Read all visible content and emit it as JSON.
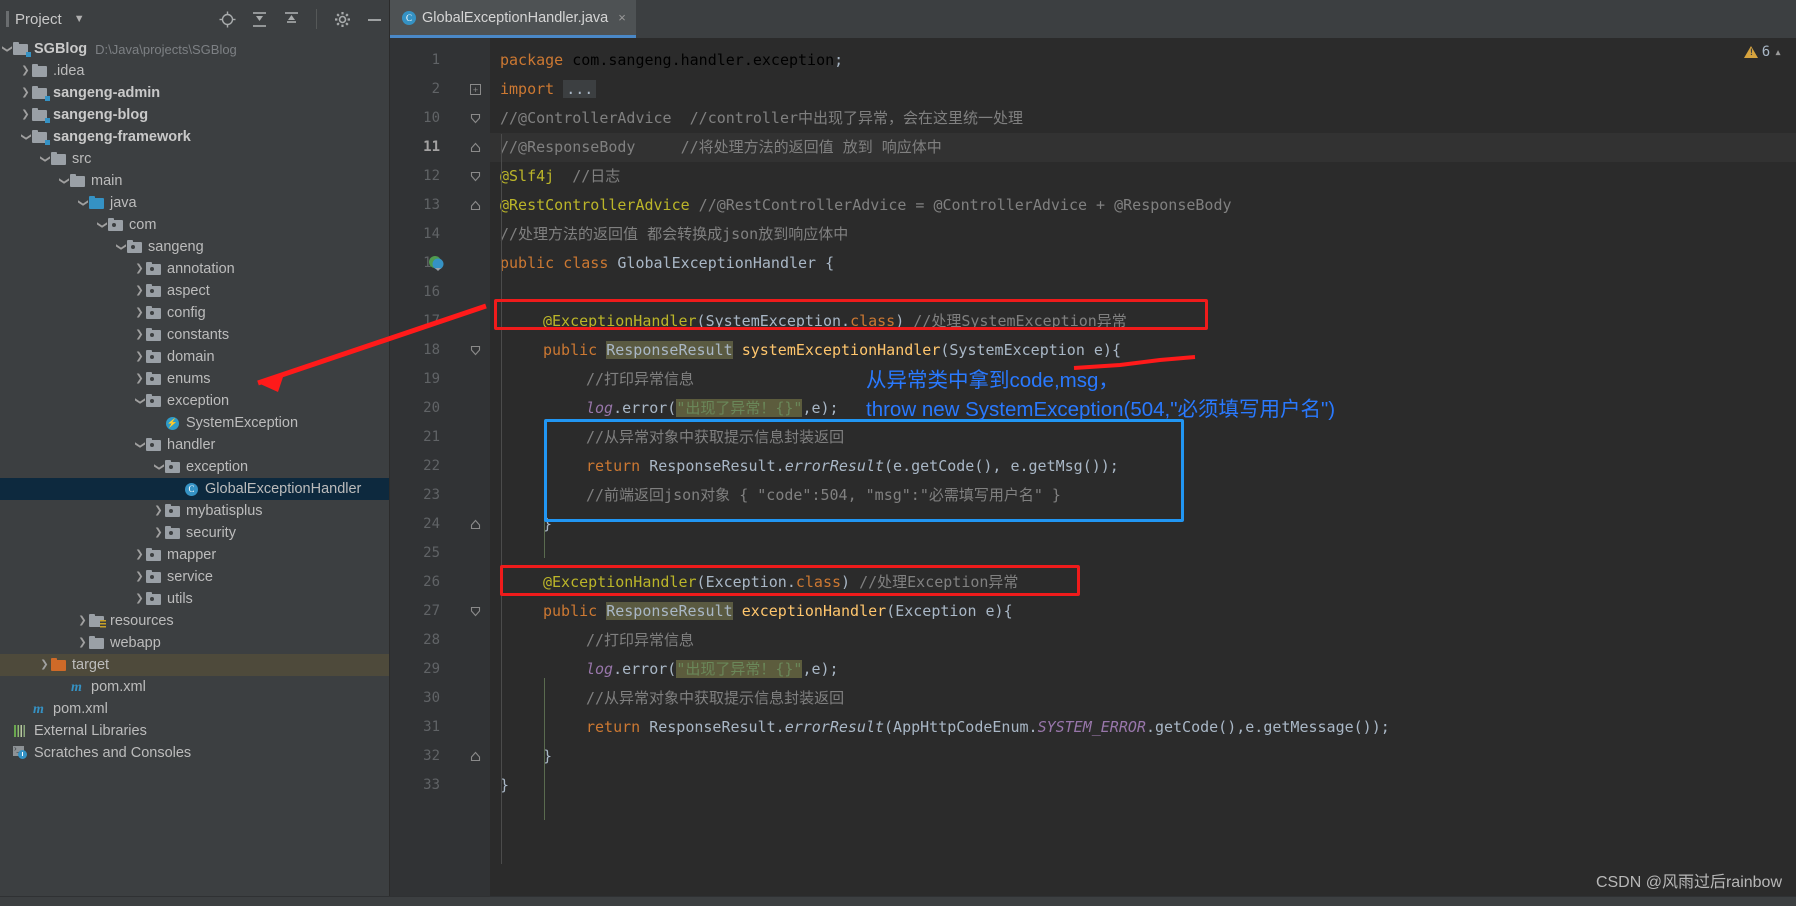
{
  "sidebar": {
    "header": {
      "title": "Project",
      "chevron": "chevron-down-icon",
      "tools": [
        "locate-icon",
        "expand-all-icon",
        "collapse-all-icon",
        "gear-icon",
        "minimize-icon"
      ]
    },
    "tree": [
      {
        "indent": 0,
        "arrow": "v",
        "icon": "module-folder",
        "label": "SGBlog",
        "bold": true,
        "path": "D:\\Java\\projects\\SGBlog"
      },
      {
        "indent": 1,
        "arrow": ">",
        "icon": "folder",
        "label": ".idea"
      },
      {
        "indent": 1,
        "arrow": ">",
        "icon": "module-folder",
        "label": "sangeng-admin",
        "bold": true
      },
      {
        "indent": 1,
        "arrow": ">",
        "icon": "module-folder",
        "label": "sangeng-blog",
        "bold": true
      },
      {
        "indent": 1,
        "arrow": "v",
        "icon": "module-folder",
        "label": "sangeng-framework",
        "bold": true
      },
      {
        "indent": 2,
        "arrow": "v",
        "icon": "folder",
        "label": "src"
      },
      {
        "indent": 3,
        "arrow": "v",
        "icon": "folder",
        "label": "main"
      },
      {
        "indent": 4,
        "arrow": "v",
        "icon": "source-folder-java",
        "label": "java"
      },
      {
        "indent": 5,
        "arrow": "v",
        "icon": "package",
        "label": "com"
      },
      {
        "indent": 6,
        "arrow": "v",
        "icon": "package",
        "label": "sangeng"
      },
      {
        "indent": 7,
        "arrow": ">",
        "icon": "package",
        "label": "annotation"
      },
      {
        "indent": 7,
        "arrow": ">",
        "icon": "package",
        "label": "aspect"
      },
      {
        "indent": 7,
        "arrow": ">",
        "icon": "package",
        "label": "config"
      },
      {
        "indent": 7,
        "arrow": ">",
        "icon": "package",
        "label": "constants"
      },
      {
        "indent": 7,
        "arrow": ">",
        "icon": "package",
        "label": "domain"
      },
      {
        "indent": 7,
        "arrow": ">",
        "icon": "package",
        "label": "enums"
      },
      {
        "indent": 7,
        "arrow": "v",
        "icon": "package",
        "label": "exception"
      },
      {
        "indent": 8,
        "arrow": "",
        "icon": "interface-class",
        "label": "SystemException"
      },
      {
        "indent": 7,
        "arrow": "v",
        "icon": "package",
        "label": "handler"
      },
      {
        "indent": 8,
        "arrow": "v",
        "icon": "package",
        "label": "exception"
      },
      {
        "indent": 9,
        "arrow": "",
        "icon": "java-class",
        "label": "GlobalExceptionHandler",
        "selected": "blue"
      },
      {
        "indent": 8,
        "arrow": ">",
        "icon": "package",
        "label": "mybatisplus"
      },
      {
        "indent": 8,
        "arrow": ">",
        "icon": "package",
        "label": "security"
      },
      {
        "indent": 7,
        "arrow": ">",
        "icon": "package",
        "label": "mapper"
      },
      {
        "indent": 7,
        "arrow": ">",
        "icon": "package",
        "label": "service"
      },
      {
        "indent": 7,
        "arrow": ">",
        "icon": "package",
        "label": "utils"
      },
      {
        "indent": 4,
        "arrow": ">",
        "icon": "resources-folder",
        "label": "resources"
      },
      {
        "indent": 4,
        "arrow": ">",
        "icon": "folder",
        "label": "webapp"
      },
      {
        "indent": 2,
        "arrow": ">",
        "icon": "target-folder",
        "label": "target",
        "selected": "olive"
      },
      {
        "indent": 3,
        "arrow": "",
        "icon": "maven-file",
        "label": "pom.xml"
      },
      {
        "indent": 1,
        "arrow": "",
        "icon": "maven-file",
        "label": "pom.xml"
      },
      {
        "indent": 0,
        "arrow": "",
        "icon": "external-libraries",
        "label": "External Libraries"
      },
      {
        "indent": 0,
        "arrow": "",
        "icon": "scratches",
        "label": "Scratches and Consoles"
      }
    ]
  },
  "editor": {
    "tab": {
      "icon": "java-class-icon",
      "title": "GlobalExceptionHandler.java",
      "close": "×"
    },
    "inspection": {
      "count": "6",
      "icon": "warning-triangle-icon",
      "chevron": "chevron-up-icon"
    },
    "current_line": 11,
    "lines": [
      {
        "n": 1,
        "fold": "none"
      },
      {
        "n": 2,
        "fold": "plus"
      },
      {
        "n": 10,
        "fold": "down"
      },
      {
        "n": 11,
        "fold": "up"
      },
      {
        "n": 12,
        "fold": "down"
      },
      {
        "n": 13,
        "fold": "up"
      },
      {
        "n": 14,
        "fold": "none"
      },
      {
        "n": 15,
        "fold": "none"
      },
      {
        "n": 16,
        "fold": "none"
      },
      {
        "n": 17,
        "fold": "none"
      },
      {
        "n": 18,
        "fold": "down"
      },
      {
        "n": 19,
        "fold": "none"
      },
      {
        "n": 20,
        "fold": "none"
      },
      {
        "n": 21,
        "fold": "none"
      },
      {
        "n": 22,
        "fold": "none"
      },
      {
        "n": 23,
        "fold": "none"
      },
      {
        "n": 24,
        "fold": "up"
      },
      {
        "n": 25,
        "fold": "none"
      },
      {
        "n": 26,
        "fold": "none"
      },
      {
        "n": 27,
        "fold": "down"
      },
      {
        "n": 28,
        "fold": "none"
      },
      {
        "n": 29,
        "fold": "none"
      },
      {
        "n": 30,
        "fold": "none"
      },
      {
        "n": 31,
        "fold": "none"
      },
      {
        "n": 32,
        "fold": "up"
      },
      {
        "n": 33,
        "fold": "none"
      }
    ],
    "code_text": {
      "l1": "package com.sangeng.handler.exception;",
      "l2": "import ...",
      "l10": "//@ControllerAdvice  //controller中出现了异常，会在这里统一处理",
      "l11": "//@ResponseBody     //将处理方法的返回值 放到 响应体中",
      "l12": "@Slf4j  //日志",
      "l13": "@RestControllerAdvice //@RestControllerAdvice = @ControllerAdvice + @ResponseBody",
      "l14": "//处理方法的返回值 都会转换成json放到响应体中",
      "l15": "public class GlobalExceptionHandler {",
      "l17": "@ExceptionHandler(SystemException.class) //处理SystemException异常",
      "l18": "public ResponseResult systemExceptionHandler(SystemException e){",
      "l19": "//打印异常信息",
      "l20": "log.error(\"出现了异常！{}\",e);",
      "l21": "//从异常对象中获取提示信息封装返回",
      "l22": "return ResponseResult.errorResult(e.getCode(), e.getMsg());",
      "l23": "//前端返回json对象 { \"code\":504, \"msg\":\"必需填写用户名\" }",
      "l24": "}",
      "l26": "@ExceptionHandler(Exception.class) //处理Exception异常",
      "l27": "public ResponseResult exceptionHandler(Exception e){",
      "l28": "//打印异常信息",
      "l29": "log.error(\"出现了异常！{}\",e);",
      "l30": "//从异常对象中获取提示信息封装返回",
      "l31": "return ResponseResult.errorResult(AppHttpCodeEnum.SYSTEM_ERROR.getCode(),e.getMessage());",
      "l32": "}",
      "l33": "}"
    }
  },
  "annotations": {
    "blue_note_line1": "从异常类中拿到code,msg，",
    "blue_note_line2": "throw new SystemException(504,\"必须填写用户名\")",
    "red_boxes": 2,
    "blue_boxes": 1,
    "red_arrow": "arrow-pointing-to-exception-package",
    "red_underline": "underline-under-systemexception-param"
  },
  "watermark": "CSDN @风雨过后rainbow",
  "colors": {
    "accent_blue": "#2979ff",
    "annotation_red": "#ef1b1b",
    "editor_bg": "#2b2b2b",
    "panel_bg": "#3c3f41",
    "selection_blue": "#0d293e",
    "selection_olive": "#4e4a3b"
  }
}
